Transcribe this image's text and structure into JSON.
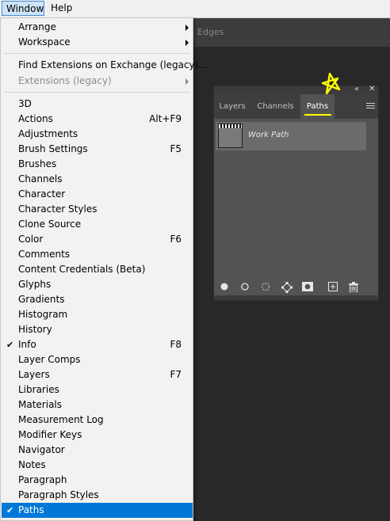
{
  "menubar": {
    "window": "Window",
    "help": "Help"
  },
  "options_bar": {
    "text": "Edges"
  },
  "menu": {
    "arrange": "Arrange",
    "workspace": "Workspace",
    "find_ext": "Find Extensions on Exchange (legacy)...",
    "extensions": "Extensions (legacy)",
    "items": [
      {
        "label": "3D",
        "shortcut": ""
      },
      {
        "label": "Actions",
        "shortcut": "Alt+F9"
      },
      {
        "label": "Adjustments",
        "shortcut": ""
      },
      {
        "label": "Brush Settings",
        "shortcut": "F5"
      },
      {
        "label": "Brushes",
        "shortcut": ""
      },
      {
        "label": "Channels",
        "shortcut": ""
      },
      {
        "label": "Character",
        "shortcut": ""
      },
      {
        "label": "Character Styles",
        "shortcut": ""
      },
      {
        "label": "Clone Source",
        "shortcut": ""
      },
      {
        "label": "Color",
        "shortcut": "F6"
      },
      {
        "label": "Comments",
        "shortcut": ""
      },
      {
        "label": "Content Credentials (Beta)",
        "shortcut": ""
      },
      {
        "label": "Glyphs",
        "shortcut": ""
      },
      {
        "label": "Gradients",
        "shortcut": ""
      },
      {
        "label": "Histogram",
        "shortcut": ""
      },
      {
        "label": "History",
        "shortcut": ""
      },
      {
        "label": "Info",
        "shortcut": "F8",
        "checked": true
      },
      {
        "label": "Layer Comps",
        "shortcut": ""
      },
      {
        "label": "Layers",
        "shortcut": "F7"
      },
      {
        "label": "Libraries",
        "shortcut": ""
      },
      {
        "label": "Materials",
        "shortcut": ""
      },
      {
        "label": "Measurement Log",
        "shortcut": ""
      },
      {
        "label": "Modifier Keys",
        "shortcut": ""
      },
      {
        "label": "Navigator",
        "shortcut": ""
      },
      {
        "label": "Notes",
        "shortcut": ""
      },
      {
        "label": "Paragraph",
        "shortcut": ""
      },
      {
        "label": "Paragraph Styles",
        "shortcut": ""
      },
      {
        "label": "Paths",
        "shortcut": "",
        "checked": true,
        "highlighted": true
      }
    ]
  },
  "panel": {
    "tabs": [
      "Layers",
      "Channels",
      "Paths"
    ],
    "active_tab": "Paths",
    "work_path": "Work Path",
    "collapse_glyph": "«",
    "close_glyph": "✕"
  },
  "colors": {
    "highlight": "#0078d7",
    "annotation": "#ffff00"
  }
}
